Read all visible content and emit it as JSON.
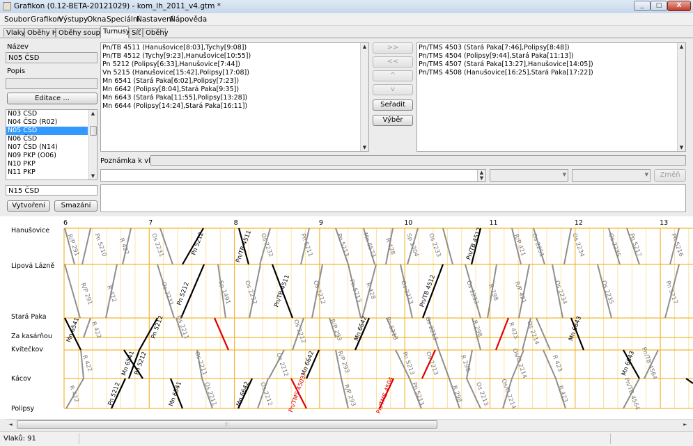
{
  "window": {
    "title": "Grafikon (0.12-BETA-20121029) - kom_lh_2011_v4.gtm *",
    "minimize": "_",
    "maximize": "□",
    "close": "X"
  },
  "menu": [
    "Soubor",
    "Grafikon",
    "Výstupy",
    "Okna",
    "Speciální",
    "Nastavení",
    "Nápověda"
  ],
  "tabs": [
    "Vlaky",
    "Oběhy HV",
    "Oběhy souprav",
    "Turnusy",
    "Síť",
    "Oběhy"
  ],
  "active_tab": "Turnusy",
  "left": {
    "name_label": "Název",
    "name_value": "N05 ČSD",
    "desc_label": "Popis",
    "desc_value": "",
    "edit_button": "Editace ...",
    "circuits": [
      {
        "label": "N03 ČSD",
        "selected": false
      },
      {
        "label": "N04 ČSD (R02)",
        "selected": false
      },
      {
        "label": "N05 ČSD",
        "selected": true
      },
      {
        "label": "N06 ČSD",
        "selected": false
      },
      {
        "label": "N07 ČSD (N14)",
        "selected": false
      },
      {
        "label": "N09 PKP (O06)",
        "selected": false
      },
      {
        "label": "N10 PKP",
        "selected": false
      },
      {
        "label": "N11 PKP",
        "selected": false
      }
    ],
    "new_name_value": "N15 ČSD",
    "create_button": "Vytvoření",
    "delete_button": "Smazání"
  },
  "center": {
    "trains_in_circuit": [
      "Pn/TB 4511 (Hanušovice[8:03],Tychy[9:08])",
      "Pn/TB 4512 (Tychy[9:23],Hanušovice[10:55])",
      "Pn 5212 (Polipsy[6:33],Hanušovice[7:44])",
      "Vn 5215 (Hanušovice[15:42],Polipsy[17:08])",
      "Mn 6541 (Stará Paka[6:02],Polipsy[7:23])",
      "Mn 6642 (Polipsy[8:04],Stará Paka[9:35])",
      "Mn 6643 (Stará Paka[11:55],Polipsy[13:28])",
      "Mn 6644 (Polipsy[14:24],Stará Paka[16:11])"
    ],
    "note_label": "Poznámka k vlaku:",
    "note_value": ""
  },
  "buttons": {
    "add": ">>",
    "remove": "<<",
    "up": "^",
    "down": "v",
    "sort": "Seřadit",
    "select": "Výběr",
    "change": "Změň"
  },
  "available_trains": [
    "Pn/TMS 4503 (Stará Paka[7:46],Polipsy[8:48])",
    "Pn/TMS 4504 (Polipsy[9:44],Stará Paka[11:13])",
    "Pn/TMS 4507 (Stará Paka[13:27],Hanušovice[14:05])",
    "Pn/TMS 4508 (Hanušovice[16:25],Stará Paka[17:22])"
  ],
  "graph": {
    "stations": [
      "Hanušovice",
      "Lipová Lázně",
      "Stará Paka",
      "Za kasárňou",
      "Kvítečkov",
      "Kácov",
      "Polipsy"
    ],
    "hours": [
      "6",
      "7",
      "8",
      "9",
      "10",
      "11",
      "12",
      "13"
    ],
    "colors": {
      "grid": "#f2b636",
      "minor": "#f8dc8c",
      "other_train": "#8e8e8e",
      "circuit_train": "#000000",
      "selected_train": "#e00000"
    },
    "labels": [
      {
        "t": "R/P 291",
        "c": "g"
      },
      {
        "t": "Pn 5210",
        "c": "g"
      },
      {
        "t": "R 422",
        "c": "g"
      },
      {
        "t": "Os 2231",
        "c": "g"
      },
      {
        "t": "Pn 5212",
        "c": "k"
      },
      {
        "t": "Pn/TB 4511",
        "c": "k"
      },
      {
        "t": "Os 2232",
        "c": "g"
      },
      {
        "t": "Pn 5211",
        "c": "g"
      },
      {
        "t": "Pn 5213",
        "c": "g"
      },
      {
        "t": "Mn 6573",
        "c": "g"
      },
      {
        "t": "R 428",
        "c": "g"
      },
      {
        "t": "Sp 1304",
        "c": "g"
      },
      {
        "t": "Os 2233",
        "c": "g"
      },
      {
        "t": "Pn/TB 4512",
        "c": "k"
      },
      {
        "t": "R/P 421",
        "c": "g"
      },
      {
        "t": "Os 2251",
        "c": "g"
      },
      {
        "t": "Os 2234",
        "c": "g"
      },
      {
        "t": "Os 2235",
        "c": "g"
      },
      {
        "t": "Pn 5217",
        "c": "g"
      },
      {
        "t": "Pn 5216",
        "c": "g"
      },
      {
        "t": "R/P 291",
        "c": "g"
      },
      {
        "t": "R 422",
        "c": "g"
      },
      {
        "t": "Os 2231",
        "c": "g"
      },
      {
        "t": "Pn 5212",
        "c": "k"
      },
      {
        "t": "Sp 1491",
        "c": "g"
      },
      {
        "t": "Os 2232",
        "c": "g"
      },
      {
        "t": "Pn/TB 4511",
        "c": "k"
      },
      {
        "t": "Os 2212",
        "c": "g"
      },
      {
        "t": "Pn 5213",
        "c": "g"
      },
      {
        "t": "R 428",
        "c": "g"
      },
      {
        "t": "Os 2213",
        "c": "g"
      },
      {
        "t": "Pn/TB 4512",
        "c": "k"
      },
      {
        "t": "Os 2233",
        "c": "g"
      },
      {
        "t": "R 298",
        "c": "g"
      },
      {
        "t": "R/P 421",
        "c": "g"
      },
      {
        "t": "Os 2234",
        "c": "g"
      },
      {
        "t": "Os 2235",
        "c": "g"
      },
      {
        "t": "Pn 5217",
        "c": "g"
      },
      {
        "t": "Mn 6541",
        "c": "k"
      },
      {
        "t": "R 422",
        "c": "g"
      },
      {
        "t": "Pn 5212",
        "c": "k"
      },
      {
        "t": "Os 2211",
        "c": "g"
      },
      {
        "t": "Os 2212",
        "c": "g"
      },
      {
        "t": "R/P 293",
        "c": "g"
      },
      {
        "t": "Mn 6642",
        "c": "k"
      },
      {
        "t": "Pn 5213",
        "c": "g"
      },
      {
        "t": "Os 2213",
        "c": "g"
      },
      {
        "t": "R 298",
        "c": "g"
      },
      {
        "t": "R 423",
        "c": "g"
      },
      {
        "t": "Os 2214",
        "c": "g"
      },
      {
        "t": "Mn 6643",
        "c": "k"
      },
      {
        "t": "R 422",
        "c": "g"
      },
      {
        "t": "Mn 6541",
        "c": "k"
      },
      {
        "t": "Pn 5212",
        "c": "k"
      },
      {
        "t": "Os 2211",
        "c": "g"
      },
      {
        "t": "Os 2212",
        "c": "g"
      },
      {
        "t": "Mn 6642",
        "c": "k"
      },
      {
        "t": "R/P 293",
        "c": "g"
      },
      {
        "t": "Pn 5213",
        "c": "g"
      },
      {
        "t": "Os 2213",
        "c": "g"
      },
      {
        "t": "R 298",
        "c": "g"
      },
      {
        "t": "Os/O 2214",
        "c": "g"
      },
      {
        "t": "R 423",
        "c": "g"
      },
      {
        "t": "Mn 6643",
        "c": "k"
      },
      {
        "t": "Pn/TB 4564",
        "c": "g"
      },
      {
        "t": "R 422",
        "c": "g"
      },
      {
        "t": "Pn 5212",
        "c": "k"
      },
      {
        "t": "Mn 6541",
        "c": "k"
      },
      {
        "t": "Os 2211",
        "c": "g"
      },
      {
        "t": "Mn 6642",
        "c": "k"
      },
      {
        "t": "Os 2212",
        "c": "g"
      },
      {
        "t": "Pn/TMS 4503",
        "c": "r"
      },
      {
        "t": "R/P 293",
        "c": "g"
      },
      {
        "t": "Pn/TMS 4504",
        "c": "r"
      },
      {
        "t": "Pn 5213",
        "c": "g"
      },
      {
        "t": "R 298",
        "c": "g"
      },
      {
        "t": "Os 2213",
        "c": "g"
      },
      {
        "t": "Os/O 2214",
        "c": "g"
      },
      {
        "t": "R 423",
        "c": "g"
      },
      {
        "t": "Pn/TB 4564",
        "c": "g"
      }
    ]
  },
  "status": {
    "trains_count": "Vlaků: 91"
  }
}
